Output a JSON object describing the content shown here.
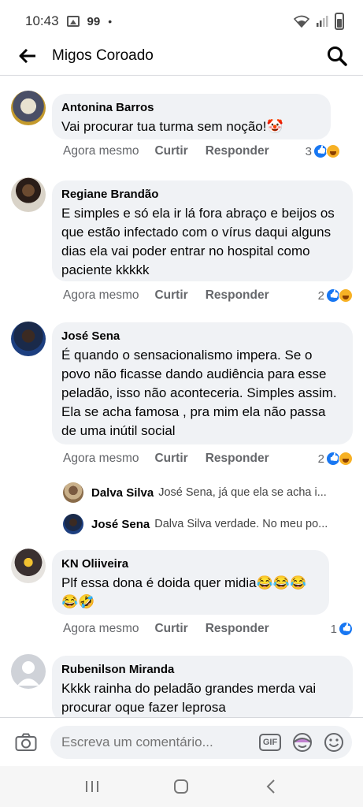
{
  "status_bar": {
    "time": "10:43",
    "badge": "99",
    "dot": "•"
  },
  "header": {
    "title": "Migos Coroado"
  },
  "comments": [
    {
      "name": "Antonina Barros",
      "text": "Vai procurar tua turma sem noção!🤡",
      "time": "Agora mesmo",
      "like": "Curtir",
      "reply": "Responder",
      "count": "3"
    },
    {
      "name": "Regiane Brandão",
      "text": "E simples e só ela ir lá fora abraço e beijos os que estão infectado com o vírus daqui alguns dias ela vai poder entrar no hospital como paciente kkkkk",
      "time": "Agora mesmo",
      "like": "Curtir",
      "reply": "Responder",
      "count": "2"
    },
    {
      "name": "José Sena",
      "text": "É quando o sensacionalismo impera. Se o povo não ficasse dando audiência para esse peladão, isso não aconteceria. Simples assim. Ela se acha famosa , pra mim ela não passa de uma inútil social",
      "time": "Agora mesmo",
      "like": "Curtir",
      "reply": "Responder",
      "count": "2"
    },
    {
      "name": "KN Oliiveira",
      "text": "Plf essa dona é doida quer midia😂😂😂😂🤣",
      "time": "Agora mesmo",
      "like": "Curtir",
      "reply": "Responder",
      "count": "1"
    },
    {
      "name": "Rubenilson Miranda",
      "text": "Kkkk rainha do peladão grandes merda vai procurar oque fazer leprosa"
    }
  ],
  "replies": [
    {
      "name": "Dalva Silva",
      "text": "José Sena, já que ela se acha i..."
    },
    {
      "name": "José Sena",
      "text": "Dalva Silva  verdade. No meu po..."
    }
  ],
  "composer": {
    "placeholder": "Escreva um comentário...",
    "gif": "GIF"
  },
  "icons": [
    "back-arrow-icon",
    "search-icon",
    "camera-icon",
    "gif-icon",
    "sticker-icon",
    "emoji-icon",
    "recents-icon",
    "home-icon",
    "back-nav-icon"
  ],
  "colors": {
    "like_blue": "#1877f2",
    "haha_yellow": "#f7b125",
    "bubble": "#f0f2f5"
  }
}
